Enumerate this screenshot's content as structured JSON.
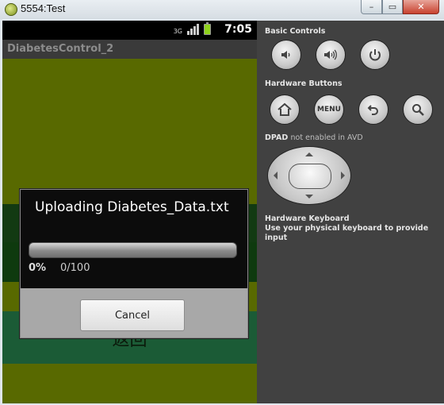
{
  "window": {
    "title": "5554:Test",
    "close_symbol": "✕",
    "min_symbol": "–",
    "max_symbol": "▭"
  },
  "status_bar": {
    "network_label": "3G",
    "time": "7:05"
  },
  "app_bar": {
    "title": "DiabetesControl_2"
  },
  "dialog": {
    "title": "Uploading Diabetes_Data.txt",
    "progress_percent_text": "0%",
    "progress_count_text": "0/100",
    "progress_fraction": 0,
    "cancel_label": "Cancel"
  },
  "content": {
    "back_label": "返回"
  },
  "controls": {
    "basic_controls_label": "Basic Controls",
    "hardware_buttons_label": "Hardware Buttons",
    "menu_label": "MENU",
    "dpad_label": "DPAD",
    "dpad_status": "not enabled in AVD",
    "keyboard_title": "Hardware Keyboard",
    "keyboard_hint": "Use your physical keyboard to provide input"
  },
  "colors": {
    "screen_bg": "#586900",
    "dialog_bg": "#0c0c0c",
    "panel_bg": "#414141",
    "back_block": "#1b5b36"
  }
}
